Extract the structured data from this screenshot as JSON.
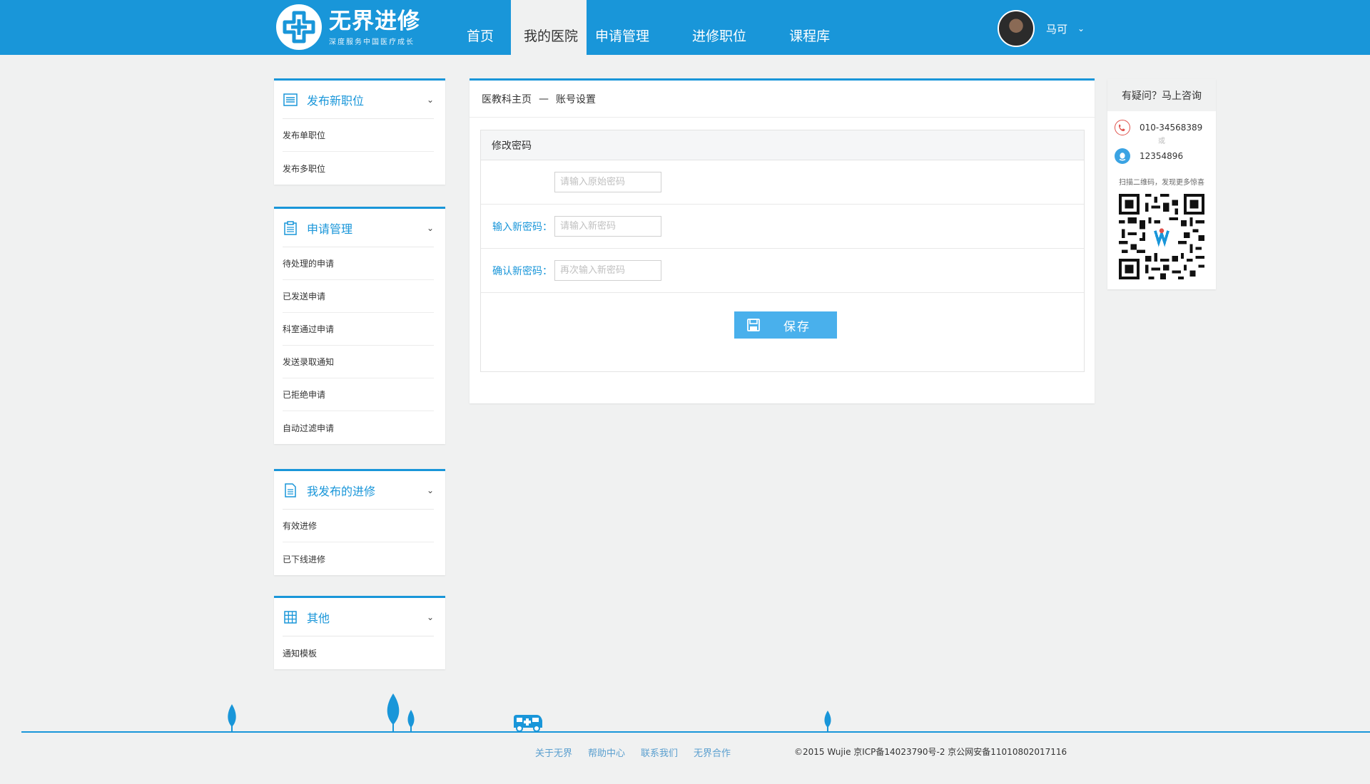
{
  "header": {
    "logo_title": "无界进修",
    "logo_subtitle": "深度服务中国医疗成长",
    "nav": [
      "首页",
      "我的医院",
      "申请管理",
      "进修职位",
      "课程库"
    ],
    "active_nav": "我的医院",
    "user_name": "马可",
    "brand_color": "#1996d9"
  },
  "sidebar": {
    "sections": [
      {
        "title": "发布新职位",
        "icon": "list-icon",
        "items": [
          "发布单职位",
          "发布多职位"
        ]
      },
      {
        "title": "申请管理",
        "icon": "clipboard-icon",
        "items": [
          "待处理的申请",
          "已发送申请",
          "科室通过申请",
          "发送录取通知",
          "已拒绝申请",
          "自动过滤申请"
        ]
      },
      {
        "title": "我发布的进修",
        "icon": "document-icon",
        "items": [
          "有效进修",
          "已下线进修"
        ]
      },
      {
        "title": "其他",
        "icon": "grid-icon",
        "items": [
          "通知模板"
        ]
      }
    ]
  },
  "main": {
    "breadcrumb": [
      "医教科主页",
      "—",
      "账号设置"
    ],
    "panel_title": "修改密码",
    "fields": [
      {
        "label": "",
        "placeholder": "请输入原始密码"
      },
      {
        "label": "输入新密码：",
        "placeholder": "请输入新密码"
      },
      {
        "label": "确认新密码：",
        "placeholder": "再次输入新密码"
      }
    ],
    "save_label": "保存"
  },
  "help": {
    "title": "有疑问？马上咨询",
    "phone": "010-34568389",
    "or": "或",
    "qq": "12354896",
    "scan_text": "扫描二维码，发现更多惊喜"
  },
  "footer": {
    "links": [
      "关于无界",
      "帮助中心",
      "联系我们",
      "无界合作"
    ],
    "copyright": "©2015 Wujie 京ICP备14023790号-2  京公网安备11010802017116"
  }
}
